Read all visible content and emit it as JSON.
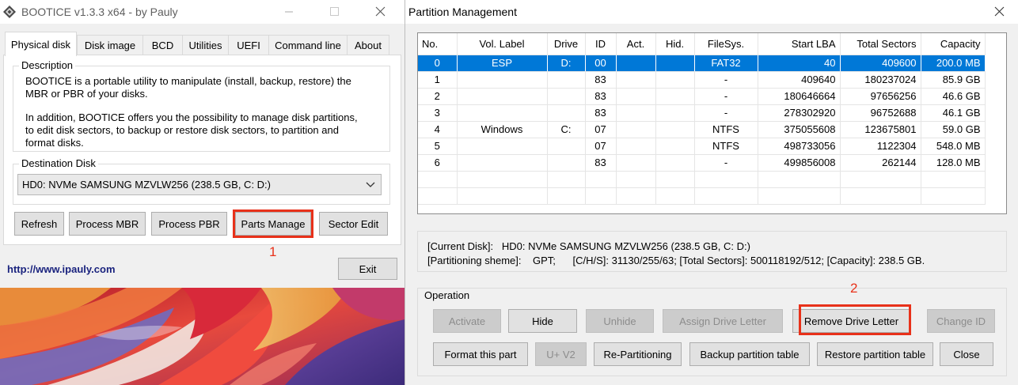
{
  "left_window": {
    "title": "BOOTICE v1.3.3 x64 - by Pauly",
    "tabs": [
      "Physical disk",
      "Disk image",
      "BCD",
      "Utilities",
      "UEFI",
      "Command line",
      "About"
    ],
    "active_tab": "Physical disk",
    "description": {
      "label": "Description",
      "line1": "BOOTICE is a portable utility to manipulate (install, backup, restore) the",
      "line2": "MBR or PBR of your disks.",
      "line3": "In addition, BOOTICE offers you the possibility to manage disk partitions,",
      "line4": "to edit disk sectors, to backup or restore disk sectors, to partition and",
      "line5": "format disks."
    },
    "destination": {
      "label": "Destination Disk",
      "selected": "HD0: NVMe SAMSUNG MZVLW256 (238.5 GB, C: D:)"
    },
    "buttons": {
      "refresh": "Refresh",
      "process_mbr": "Process MBR",
      "process_pbr": "Process PBR",
      "parts_manage": "Parts Manage",
      "sector_edit": "Sector Edit",
      "exit": "Exit"
    },
    "callout": "1",
    "link": "http://www.ipauly.com"
  },
  "right_window": {
    "title": "Partition Management",
    "columns": [
      "No.",
      "Vol. Label",
      "Drive",
      "ID",
      "Act.",
      "Hid.",
      "FileSys.",
      "Start LBA",
      "Total Sectors",
      "Capacity"
    ],
    "rows": [
      [
        "0",
        "ESP",
        "D:",
        "00",
        "",
        "",
        "FAT32",
        "40",
        "409600",
        "200.0 MB"
      ],
      [
        "1",
        "",
        "",
        "83",
        "",
        "",
        "-",
        "409640",
        "180237024",
        "85.9 GB"
      ],
      [
        "2",
        "",
        "",
        "83",
        "",
        "",
        "-",
        "180646664",
        "97656256",
        "46.6 GB"
      ],
      [
        "3",
        "",
        "",
        "83",
        "",
        "",
        "-",
        "278302920",
        "96752688",
        "46.1 GB"
      ],
      [
        "4",
        "Windows",
        "C:",
        "07",
        "",
        "",
        "NTFS",
        "375055608",
        "123675801",
        "59.0 GB"
      ],
      [
        "5",
        "",
        "",
        "07",
        "",
        "",
        "NTFS",
        "498733056",
        "1122304",
        "548.0 MB"
      ],
      [
        "6",
        "",
        "",
        "83",
        "",
        "",
        "-",
        "499856008",
        "262144",
        "128.0 MB"
      ]
    ],
    "selected_row": 0,
    "info": {
      "line1": "[Current Disk]:   HD0: NVMe SAMSUNG MZVLW256 (238.5 GB, C: D:)",
      "line2": "[Partitioning sheme]:    GPT;      [C/H/S]: 31130/255/63; [Total Sectors]: 500118192/512; [Capacity]: 238.5 GB."
    },
    "operation": {
      "label": "Operation",
      "activate": "Activate",
      "hide": "Hide",
      "unhide": "Unhide",
      "assign_drive_letter": "Assign Drive Letter",
      "remove_drive_letter": "Remove Drive Letter",
      "change_id": "Change ID",
      "format_this_part": "Format this part",
      "uplus_v2": "U+ V2",
      "re_partitioning": "Re-Partitioning",
      "backup_partition_table": "Backup partition table",
      "restore_partition_table": "Restore partition table",
      "close": "Close"
    },
    "callout": "2"
  },
  "colors": {
    "selection": "#0078d7",
    "highlight_box": "#e8311a",
    "window_bg": "#f0f0f0"
  },
  "icons": {
    "app": "bootice-diamond-icon",
    "minimize": "minimize-icon",
    "maximize": "maximize-icon",
    "close": "close-icon",
    "dropdown": "chevron-down-icon"
  }
}
